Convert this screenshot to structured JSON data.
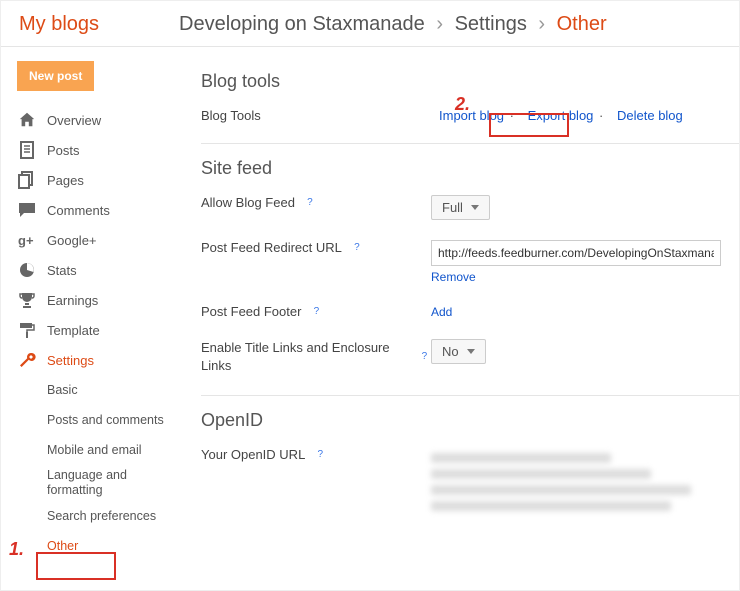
{
  "header": {
    "my_blogs": "My blogs",
    "blog_name": "Developing on Staxmanade",
    "crumb_settings": "Settings",
    "crumb_other": "Other",
    "sep": "›"
  },
  "sidebar": {
    "new_post": "New post",
    "items": [
      {
        "label": "Overview"
      },
      {
        "label": "Posts"
      },
      {
        "label": "Pages"
      },
      {
        "label": "Comments"
      },
      {
        "label": "Google+"
      },
      {
        "label": "Stats"
      },
      {
        "label": "Earnings"
      },
      {
        "label": "Template"
      },
      {
        "label": "Settings"
      }
    ],
    "subitems": [
      {
        "label": "Basic"
      },
      {
        "label": "Posts and comments"
      },
      {
        "label": "Mobile and email"
      },
      {
        "label": "Language and formatting"
      },
      {
        "label": "Search preferences"
      },
      {
        "label": "Other"
      }
    ]
  },
  "main": {
    "blog_tools_title": "Blog tools",
    "blog_tools_label": "Blog Tools",
    "import_blog": "Import blog",
    "export_blog": "Export blog",
    "delete_blog": "Delete blog",
    "dash": "·",
    "site_feed_title": "Site feed",
    "allow_feed_label": "Allow Blog Feed",
    "allow_feed_value": "Full",
    "redirect_label": "Post Feed Redirect URL",
    "redirect_value": "http://feeds.feedburner.com/DevelopingOnStaxmanade",
    "remove": "Remove",
    "footer_label": "Post Feed Footer",
    "add": "Add",
    "enclosure_label": "Enable Title Links and Enclosure Links",
    "enclosure_value": "No",
    "openid_title": "OpenID",
    "openid_label": "Your OpenID URL"
  },
  "annotations": {
    "n1": "1.",
    "n2": "2."
  }
}
